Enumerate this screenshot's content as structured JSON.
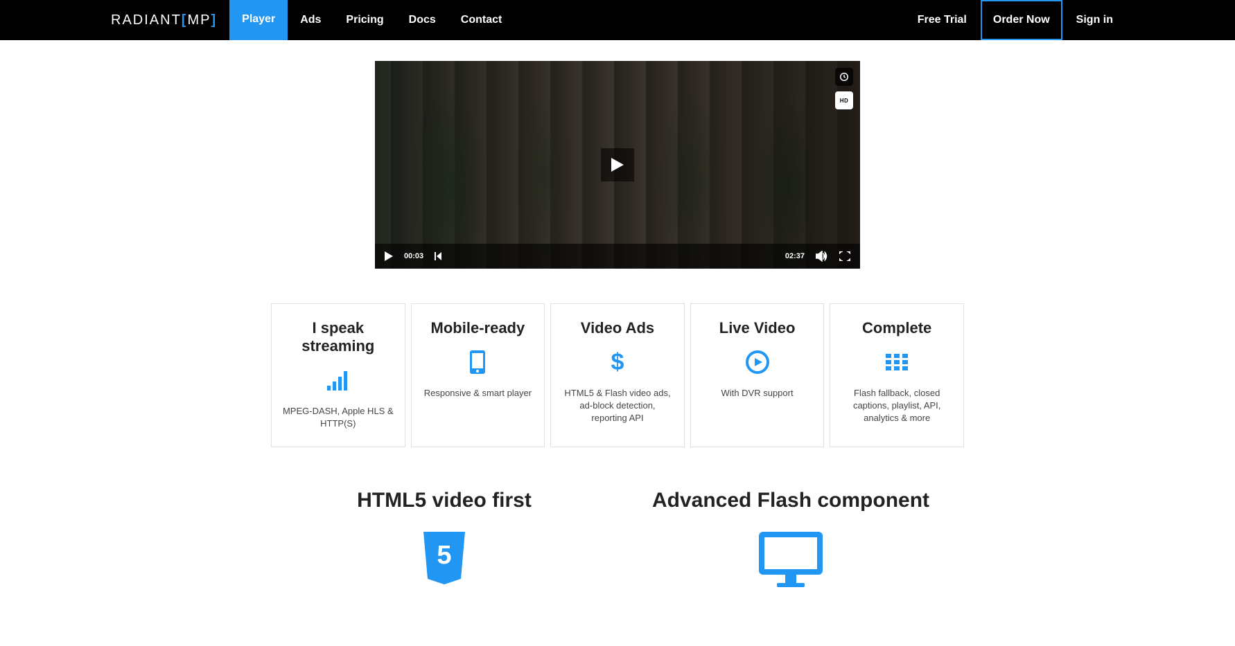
{
  "brand": {
    "name": "RADIANT",
    "suffix": "MP"
  },
  "nav": {
    "items": [
      {
        "label": "Player",
        "active": true
      },
      {
        "label": "Ads",
        "active": false
      },
      {
        "label": "Pricing",
        "active": false
      },
      {
        "label": "Docs",
        "active": false
      },
      {
        "label": "Contact",
        "active": false
      }
    ],
    "right": {
      "free_trial": "Free Trial",
      "order_now": "Order Now",
      "sign_in": "Sign in"
    }
  },
  "video": {
    "current_time": "00:03",
    "duration": "02:37",
    "hd_label": "HD"
  },
  "features": [
    {
      "title": "I speak streaming",
      "icon": "signal",
      "desc": "MPEG-DASH, Apple HLS & HTTP(S)"
    },
    {
      "title": "Mobile-ready",
      "icon": "mobile",
      "desc": "Responsive & smart player"
    },
    {
      "title": "Video Ads",
      "icon": "dollar",
      "desc": "HTML5 & Flash video ads, ad-block detection, reporting API"
    },
    {
      "title": "Live Video",
      "icon": "play-circle",
      "desc": "With DVR support"
    },
    {
      "title": "Complete",
      "icon": "grid",
      "desc": "Flash fallback, closed captions, playlist, API, analytics & more"
    }
  ],
  "bottom": {
    "left_title": "HTML5 video first",
    "right_title": "Advanced Flash component"
  }
}
